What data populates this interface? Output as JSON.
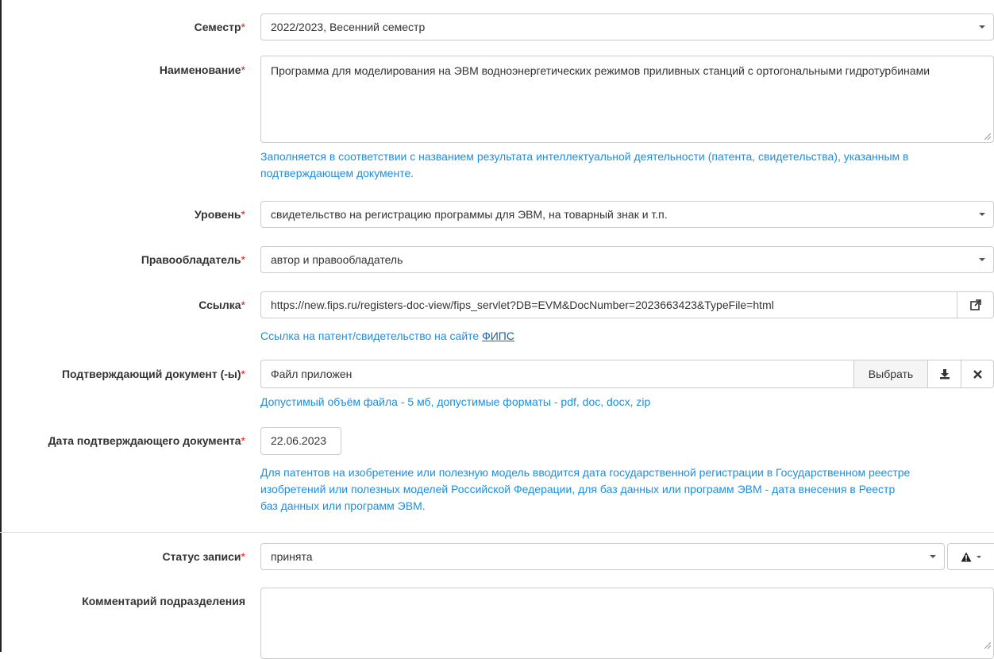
{
  "form": {
    "semester": {
      "label": "Семестр",
      "required": "*",
      "value": "2022/2023, Весенний семестр"
    },
    "name": {
      "label": "Наименование",
      "required": "*",
      "value": "Программа для моделирования на ЭВМ водноэнергетических режимов приливных станций с ортогональными гидротурбинами",
      "help_line1": "Заполняется в соответствии с названием результата интеллектуальной деятельности (патента, свидетельства), указанным в",
      "help_line2": "подтверждающем документе."
    },
    "level": {
      "label": "Уровень",
      "required": "*",
      "value": "свидетельство на регистрацию программы для ЭВМ, на товарный знак и т.п."
    },
    "rightholder": {
      "label": "Правообладатель",
      "required": "*",
      "value": "автор и правообладатель"
    },
    "link": {
      "label": "Ссылка",
      "required": "*",
      "value": "https://new.fips.ru/registers-doc-view/fips_servlet?DB=EVM&DocNumber=2023663423&TypeFile=html",
      "help_prefix": "Ссылка на патент/свидетельство на сайте ",
      "help_link": "ФИПС"
    },
    "document": {
      "label": "Подтверждающий документ (-ы)",
      "required": "*",
      "value": "Файл приложен",
      "choose_label": "Выбрать",
      "help": "Допустимый объём файла - 5 мб, допустимые форматы - pdf, doc, docx, zip"
    },
    "doc_date": {
      "label": "Дата подтверждающего документа",
      "required": "*",
      "value": "22.06.2023",
      "help_line1": "Для патентов на изобретение или полезную модель вводится дата государственной регистрации в Государственном реестре",
      "help_line2": "изобретений или полезных моделей Российской Федерации, для баз данных или программ ЭВМ - дата внесения в Реестр",
      "help_line3": "баз данных или программ ЭВМ."
    },
    "status": {
      "label": "Статус записи",
      "required": "*",
      "value": "принята"
    },
    "comment": {
      "label": "Комментарий подразделения",
      "value": ""
    }
  },
  "icons": {
    "caret": "chevron-down-icon",
    "external_link": "external-link-icon",
    "download": "download-icon",
    "remove": "close-icon",
    "warning": "warning-icon"
  }
}
